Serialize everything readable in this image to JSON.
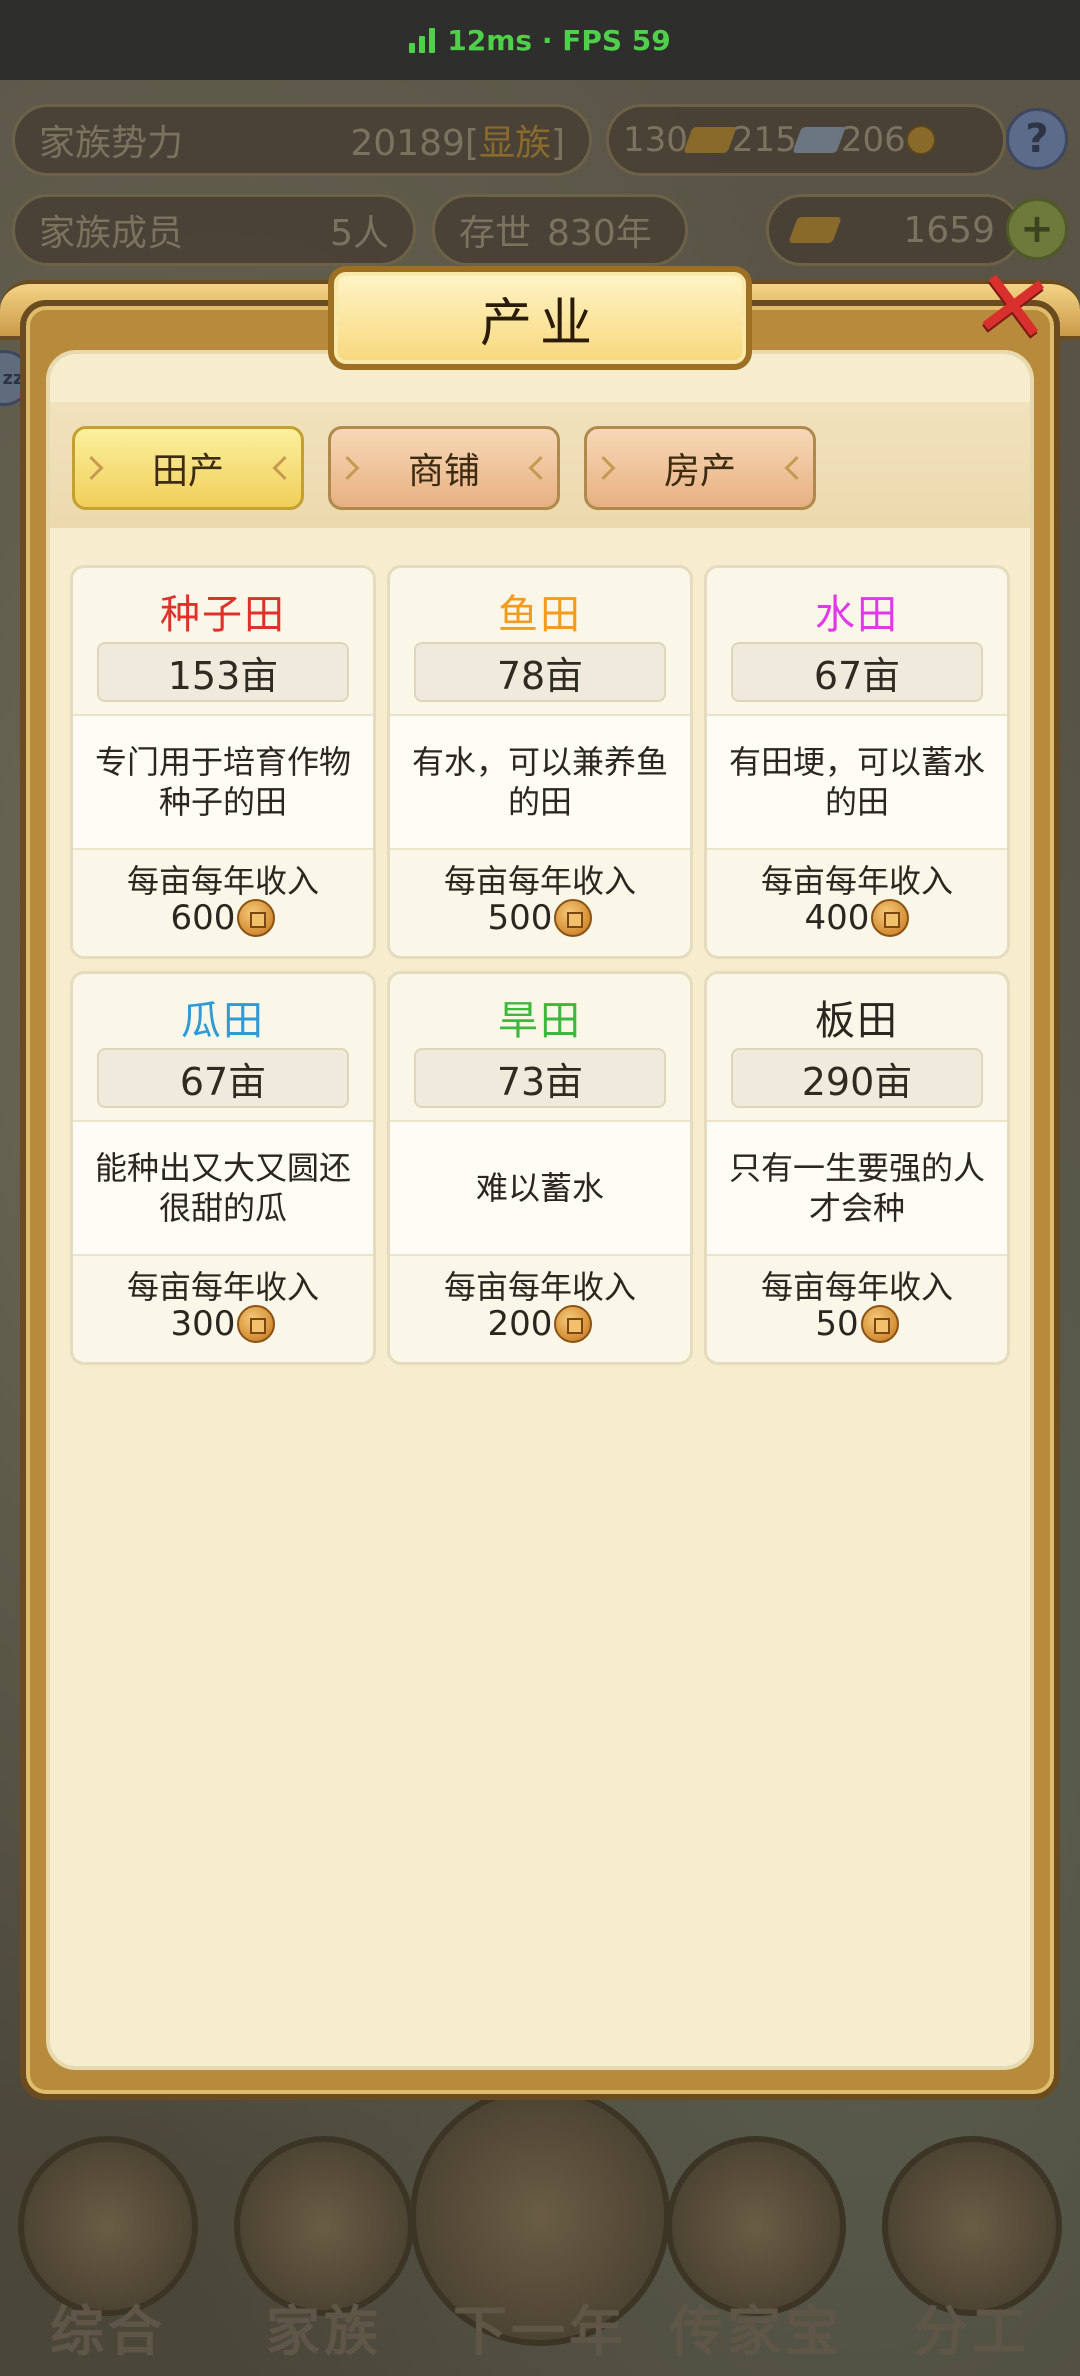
{
  "status": {
    "latency": "12ms · FPS 59"
  },
  "hud": {
    "power_label": "家族势力",
    "power_value": "20189",
    "power_tag_open": "[",
    "power_tag": "显族",
    "power_tag_close": "]",
    "gold_bars": "130",
    "silver_bars": "215",
    "coins": "206",
    "help": "?",
    "members_label": "家族成员",
    "members_value": "5人",
    "years_label": "存世",
    "years_value": "830年",
    "ingots": "1659",
    "plus": "+",
    "side_badge": "zz"
  },
  "modal": {
    "title": "产业",
    "close": "✕",
    "tabs": [
      {
        "label": "田产",
        "active": true
      },
      {
        "label": "商铺",
        "active": false
      },
      {
        "label": "房产",
        "active": false
      }
    ]
  },
  "cards": [
    {
      "name": "种子田",
      "color": "#e0302a",
      "area": "153亩",
      "desc": "专门用于培育作物种子的田",
      "income_label": "每亩每年收入",
      "income": "600"
    },
    {
      "name": "鱼田",
      "color": "#f29b1c",
      "area": "78亩",
      "desc": "有水，可以兼养鱼的田",
      "income_label": "每亩每年收入",
      "income": "500"
    },
    {
      "name": "水田",
      "color": "#e03ae8",
      "area": "67亩",
      "desc": "有田埂，可以蓄水的田",
      "income_label": "每亩每年收入",
      "income": "400"
    },
    {
      "name": "瓜田",
      "color": "#2e9ad8",
      "area": "67亩",
      "desc": "能种出又大又圆还很甜的瓜",
      "income_label": "每亩每年收入",
      "income": "300"
    },
    {
      "name": "旱田",
      "color": "#3cb83c",
      "area": "73亩",
      "desc": "难以蓄水",
      "income_label": "每亩每年收入",
      "income": "200"
    },
    {
      "name": "板田",
      "color": "#2a2620",
      "area": "290亩",
      "desc": "只有一生要强的人才会种",
      "income_label": "每亩每年收入",
      "income": "50"
    }
  ],
  "nav": [
    {
      "label": "综合"
    },
    {
      "label": "家族"
    },
    {
      "label": "下一年"
    },
    {
      "label": "传家宝"
    },
    {
      "label": "分工"
    }
  ]
}
